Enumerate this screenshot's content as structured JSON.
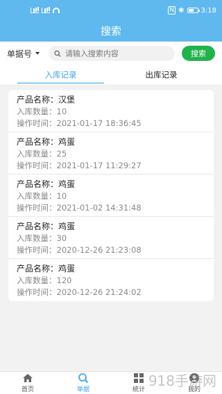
{
  "status": {
    "time": "3:18",
    "nfc": "N"
  },
  "header": {
    "title": "搜索"
  },
  "search": {
    "type_label": "单据号",
    "placeholder": "请输入搜索内容",
    "button_label": "搜索"
  },
  "tabs": [
    {
      "label": "入库记录",
      "active": true
    },
    {
      "label": "出库记录",
      "active": false
    }
  ],
  "records": [
    {
      "name_label": "产品名称：",
      "name": "汉堡",
      "qty_label": "入库数量：",
      "qty": "10",
      "time_label": "操作时间：",
      "time": "2021-01-17 18:36:45"
    },
    {
      "name_label": "产品名称：",
      "name": "鸡蛋",
      "qty_label": "入库数量：",
      "qty": "25",
      "time_label": "操作时间：",
      "time": "2021-01-17 11:29:27"
    },
    {
      "name_label": "产品名称：",
      "name": "鸡蛋",
      "qty_label": "入库数量：",
      "qty": "10",
      "time_label": "操作时间：",
      "time": "2021-01-02 14:31:48"
    },
    {
      "name_label": "产品名称：",
      "name": "鸡蛋",
      "qty_label": "入库数量：",
      "qty": "30",
      "time_label": "操作时间：",
      "time": "2020-12-26 21:23:08"
    },
    {
      "name_label": "产品名称：",
      "name": "鸡蛋",
      "qty_label": "入库数量：",
      "qty": "120",
      "time_label": "操作时间：",
      "time": "2020-12-26 21:24:02"
    }
  ],
  "nav": [
    {
      "label": "首页",
      "icon": "home-icon",
      "active": false
    },
    {
      "label": "单据",
      "icon": "search-icon",
      "active": true
    },
    {
      "label": "统计",
      "icon": "grid-icon",
      "active": false
    },
    {
      "label": "我的",
      "icon": "user-icon",
      "active": false
    }
  ],
  "watermark": "918手游网",
  "colors": {
    "header": "#5fb8ee",
    "accent": "#3da6e6",
    "button": "#22b24c"
  }
}
